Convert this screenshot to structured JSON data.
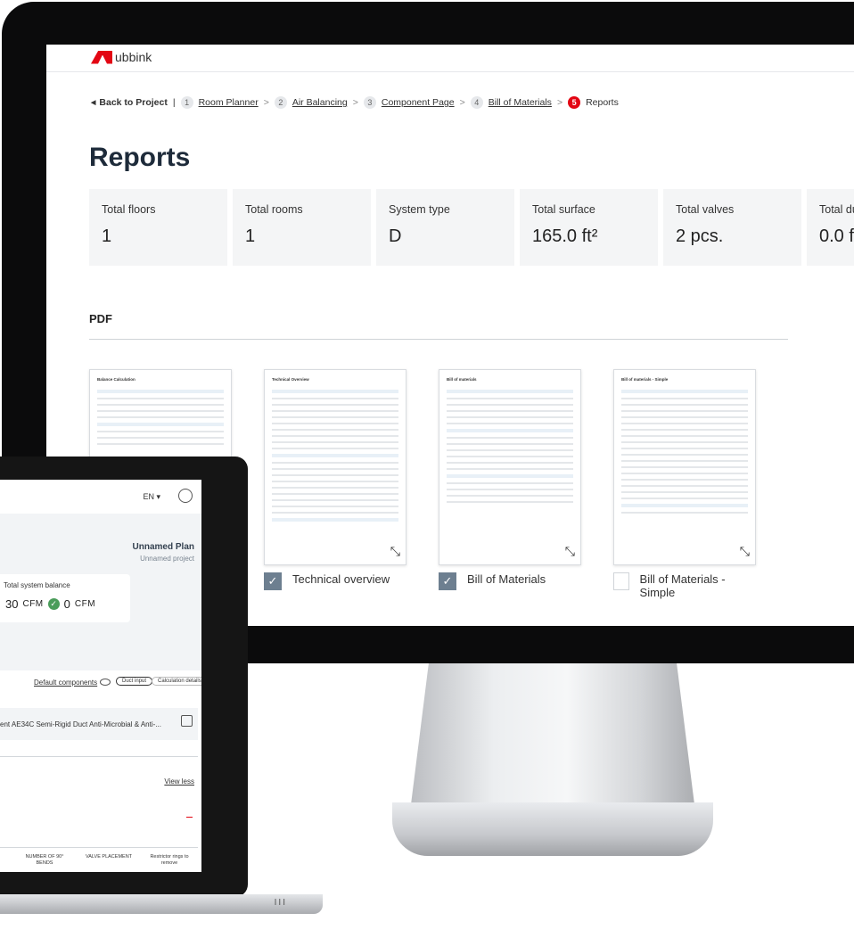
{
  "brand": {
    "name": "ubbink",
    "accent": "#e30613"
  },
  "breadcrumb": {
    "back_label": "Back to Project",
    "divider": "|",
    "steps": [
      {
        "num": "1",
        "label": "Room Planner"
      },
      {
        "num": "2",
        "label": "Air Balancing"
      },
      {
        "num": "3",
        "label": "Component Page"
      },
      {
        "num": "4",
        "label": "Bill of Materials"
      },
      {
        "num": "5",
        "label": "Reports"
      }
    ]
  },
  "page_title": "Reports",
  "stats": [
    {
      "label": "Total floors",
      "value": "1"
    },
    {
      "label": "Total rooms",
      "value": "1"
    },
    {
      "label": "System type",
      "value": "D"
    },
    {
      "label": "Total surface",
      "value": "165.0 ft²"
    },
    {
      "label": "Total valves",
      "value": "2 pcs."
    },
    {
      "label": "Total du",
      "value": "0.0 f"
    }
  ],
  "pdf_section": {
    "title": "PDF"
  },
  "documents": [
    {
      "thumb_title": "Balance Calculation",
      "label": "",
      "checked": false
    },
    {
      "thumb_title": "Technical Overview",
      "label": "Technical overview",
      "checked": true
    },
    {
      "thumb_title": "Bill of materials",
      "label": "Bill of Materials",
      "checked": true
    },
    {
      "thumb_title": "Bill of materials - Simple",
      "label": "Bill of Materials - Simple",
      "checked": false
    }
  ],
  "laptop": {
    "language": "EN ▾",
    "plan_name": "Unnamed Plan",
    "project_name": "Unnamed project",
    "balance_label": "Total system balance",
    "balance_left": "30",
    "balance_right": "0",
    "balance_unit": "CFM",
    "default_components": "Default components",
    "duct_input": "Duct input",
    "calculation_details": "Calculation details",
    "component_text": "ent AE34C Semi-Rigid Duct Anti-Microbial & Anti-...",
    "view_less": "View less",
    "col_bends": "NUMBER OF 90° BENDS",
    "col_valve": "VALVE PLACEMENT",
    "col_rings": "Restrictor rings to remove"
  }
}
